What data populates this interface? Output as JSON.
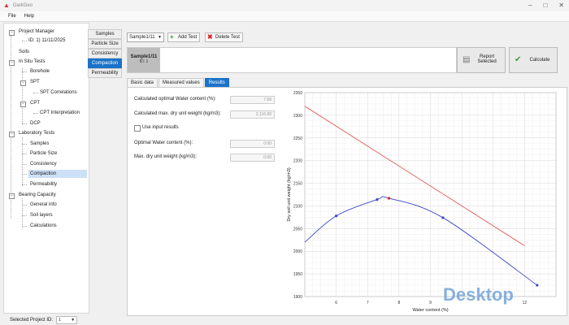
{
  "app": {
    "title": "DarkGeo"
  },
  "menu": [
    "File",
    "Help"
  ],
  "tree": {
    "project_manager": "Project Manager",
    "project_item": "ID: 1) 11/11/2025",
    "soils": "Soils",
    "in_situ_tests": "In Situ Tests",
    "borehole": "Borehole",
    "spt": "SPT",
    "spt_correlations": "SPT Correlations",
    "cpt": "CPT",
    "cpt_interpretation": "CPT Interpretation",
    "dcp": "DCP",
    "laboratory_tests": "Laboratory Tests",
    "samples": "Samples",
    "particle_size": "Particle Size",
    "consistency": "Consistency",
    "compaction": "Compaction",
    "permeability": "Permeability",
    "bearing_capacity": "Bearing Capacity",
    "general_info": "General info",
    "soil_layers": "Soil layers",
    "calculations": "Calculations"
  },
  "selected_project": {
    "label": "Selected Project ID:",
    "value": "1"
  },
  "vtabs": [
    "Samples",
    "Particle Size",
    "Consistency",
    "Compaction",
    "Permeability"
  ],
  "toolbar": {
    "sample_select": "Sample1/11",
    "add_test": "Add Test",
    "delete_test": "Delete Test"
  },
  "sample_card": {
    "name": "Sample1/11",
    "id": "ID: 1"
  },
  "buttons": {
    "report_line1": "Report",
    "report_line2": "Selected",
    "calculate": "Calculate"
  },
  "inner_tabs": [
    "Basic data",
    "Measured values",
    "Results"
  ],
  "results": {
    "opt_water_label": "Calculated optimal Water content (%):",
    "opt_water_value": "7.68",
    "max_dry_label": "Calculated max. dry unit weight (kg/m3):",
    "max_dry_value": "2,116.90",
    "use_input_label": "Use input results",
    "opt_input_label": "Optimal Water content (%):",
    "opt_input_value": "0.00",
    "max_input_label": "Max. dry unit weight (kg/m3):",
    "max_input_value": "0.00"
  },
  "chart_data": {
    "type": "line",
    "xlabel": "Water content (%)",
    "ylabel": "Dry soil unit weight (kg/m3)",
    "xlim": [
      5,
      13
    ],
    "ylim": [
      1900,
      2350
    ],
    "x_ticks": [
      6,
      7,
      8,
      9,
      10,
      11,
      12
    ],
    "y_ticks": [
      1900,
      1950,
      2000,
      2050,
      2100,
      2150,
      2200,
      2250,
      2300,
      2350
    ],
    "x_tick_labels": [
      "6",
      "7",
      "8",
      "9",
      "",
      "",
      "12"
    ],
    "y_tick_labels": [
      "1900",
      "1950",
      "2000",
      "2050",
      "2100",
      "2150",
      "2200",
      "2250",
      "2300",
      "2350"
    ],
    "grid": true,
    "series": [
      {
        "color": "#3a45c8",
        "kind": "curve",
        "x": [
          5.0,
          6.0,
          7.3,
          7.68,
          9.4,
          12.4
        ],
        "y": [
          2020,
          2078,
          2114,
          2116.9,
          2074,
          1925
        ]
      },
      {
        "color": "#e05a5a",
        "kind": "line",
        "x": [
          5.0,
          12.0
        ],
        "y": [
          2320,
          2012
        ]
      }
    ],
    "points": [
      {
        "x": 6.0,
        "y": 2078,
        "color": "#3a45c8"
      },
      {
        "x": 7.3,
        "y": 2114,
        "color": "#3a45c8"
      },
      {
        "x": 7.68,
        "y": 2116.9,
        "color": "#e02020"
      },
      {
        "x": 9.4,
        "y": 2074,
        "color": "#3a45c8"
      },
      {
        "x": 12.4,
        "y": 1925,
        "color": "#3a45c8"
      }
    ]
  },
  "watermark": "Desktop"
}
